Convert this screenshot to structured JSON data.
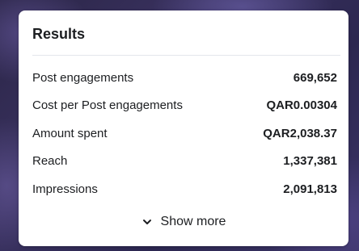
{
  "results": {
    "title": "Results",
    "rows": [
      {
        "label": "Post engagements",
        "value": "669,652"
      },
      {
        "label": "Cost per Post engagements",
        "value": "QAR0.00304"
      },
      {
        "label": "Amount spent",
        "value": "QAR2,038.37"
      },
      {
        "label": "Reach",
        "value": "1,337,381"
      },
      {
        "label": "Impressions",
        "value": "2,091,813"
      }
    ],
    "show_more_label": "Show more",
    "show_more_icon": "chevron-down-icon"
  }
}
